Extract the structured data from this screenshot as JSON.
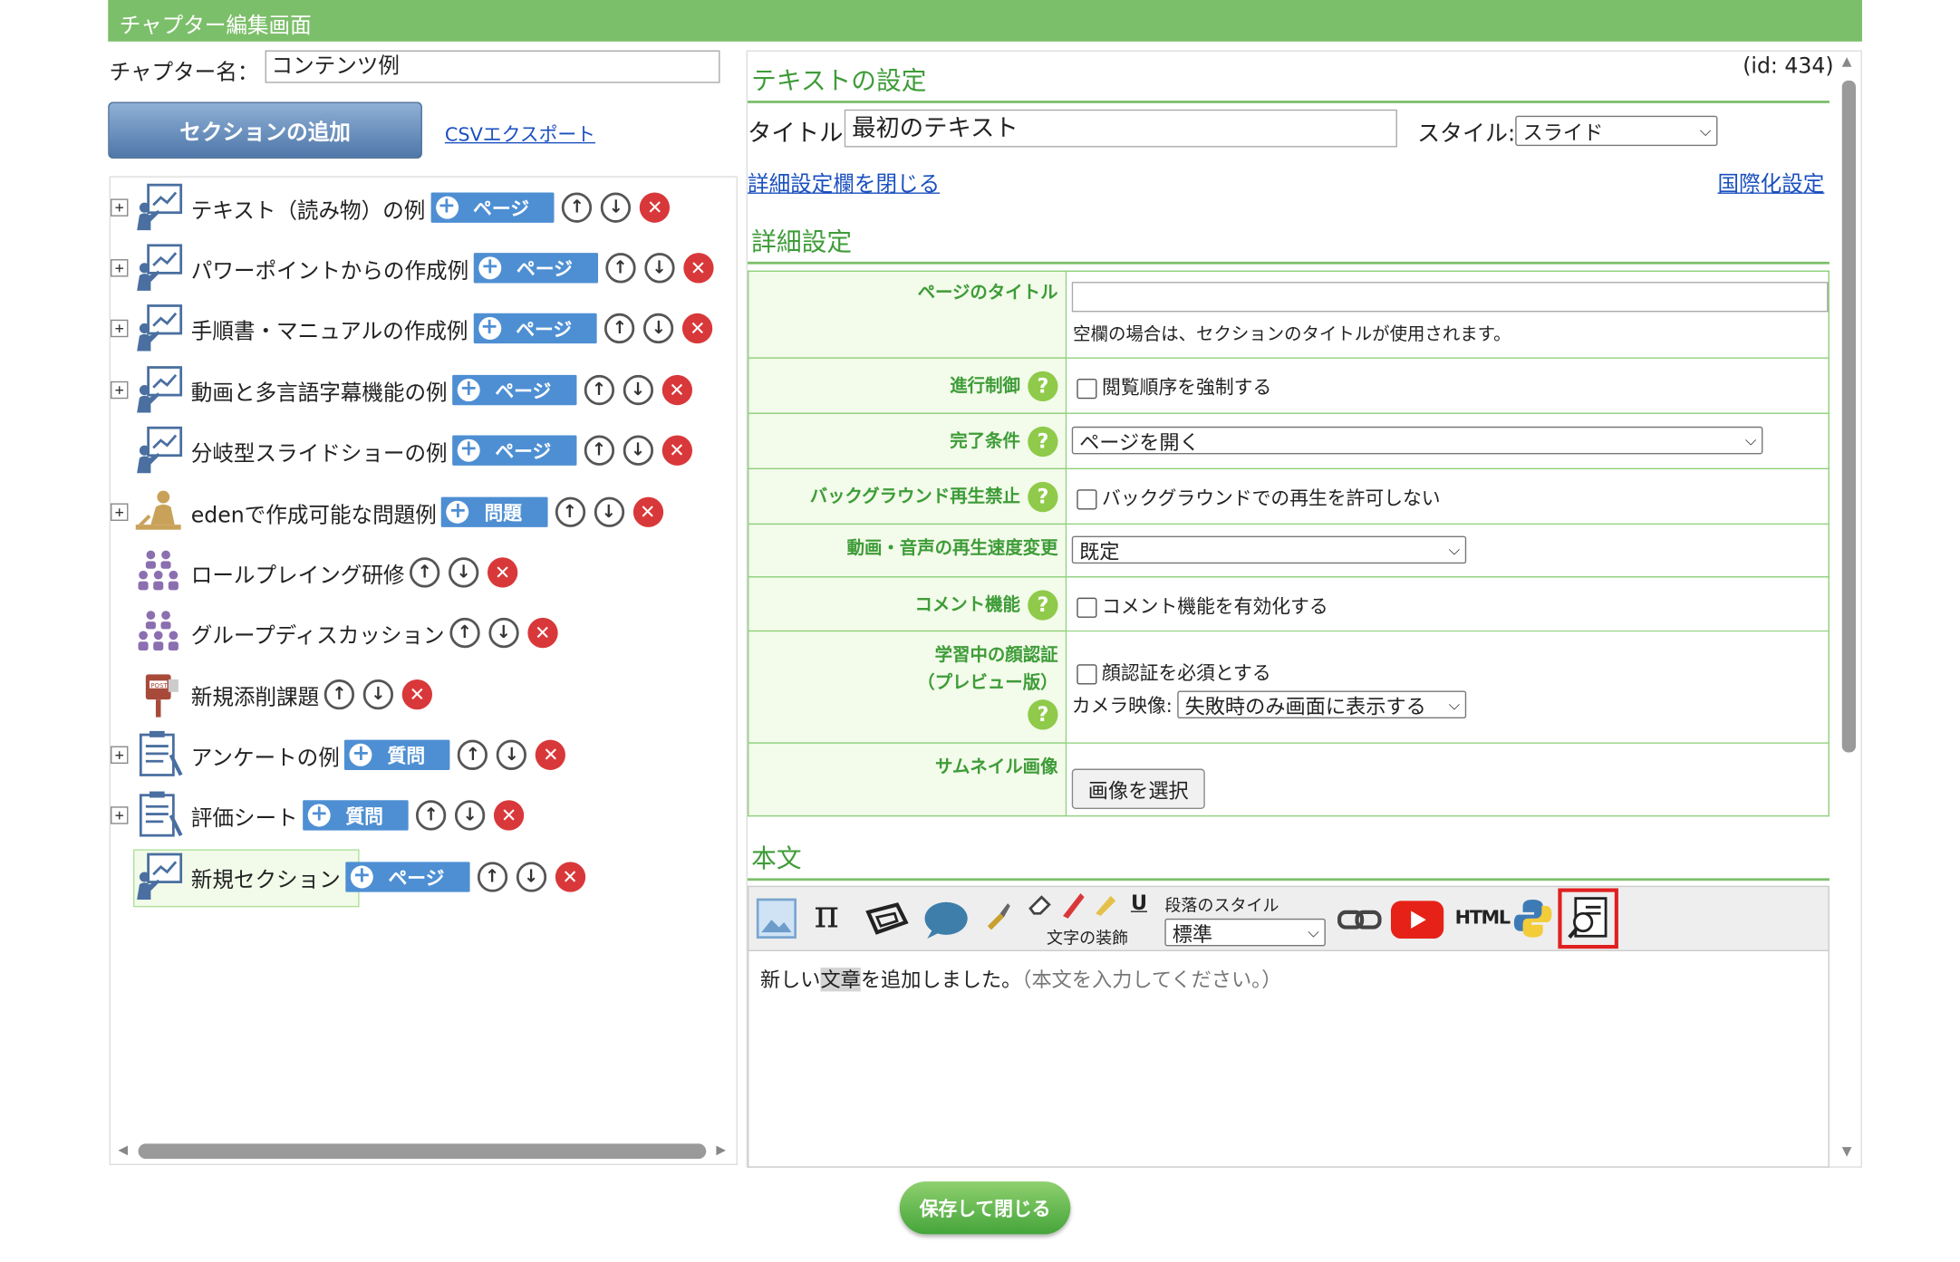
{
  "header": {
    "title": "チャプター編集画面"
  },
  "chapter": {
    "name_label": "チャプター名：",
    "name_value": "コンテンツ例"
  },
  "left": {
    "add_section_label": "セクションの追加",
    "csv_export_label": "CSVエクスポート",
    "sections": [
      {
        "label": "テキスト（読み物）の例",
        "button": "ページ"
      },
      {
        "label": "パワーポイントからの作成例",
        "button": "ページ"
      },
      {
        "label": "手順書・マニュアルの作成例",
        "button": "ページ"
      },
      {
        "label": "動画と多言語字幕機能の例",
        "button": "ページ"
      },
      {
        "label": "分岐型スライドショーの例",
        "button": "ページ"
      },
      {
        "label": "edenで作成可能な問題例",
        "button": "問題"
      },
      {
        "label": "ロールプレイング研修"
      },
      {
        "label": "グループディスカッション"
      },
      {
        "label": "新規添削課題"
      },
      {
        "label": "アンケートの例",
        "button": "質問"
      },
      {
        "label": "評価シート",
        "button": "質問"
      },
      {
        "label": "新規セクション",
        "button": "ページ"
      }
    ]
  },
  "right": {
    "id_label": "(id: 434)",
    "text_settings_heading": "テキストの設定",
    "title_label": "タイトル:",
    "title_value": "最初のテキスト",
    "style_label": "スタイル:",
    "style_value": "スライド",
    "close_detail_link": "詳細設定欄を閉じる",
    "i18n_link": "国際化設定",
    "detail_heading": "詳細設定",
    "details": {
      "page_title_label": "ページのタイトル",
      "page_title_hint": "空欄の場合は、セクションのタイトルが使用されます。",
      "progress_label": "進行制御",
      "progress_option": "閲覧順序を強制する",
      "completion_label": "完了条件",
      "completion_value": "ページを開く",
      "bg_label": "バックグラウンド再生禁止",
      "bg_option": "バックグラウンドでの再生を許可しない",
      "speed_label": "動画・音声の再生速度変更",
      "speed_value": "既定",
      "comment_label": "コメント機能",
      "comment_option": "コメント機能を有効化する",
      "face_label_1": "学習中の顔認証",
      "face_label_2": "（プレビュー版）",
      "face_option": "顔認証を必須とする",
      "camera_label": "カメラ映像:",
      "camera_value": "失敗時のみ画面に表示する",
      "thumb_label": "サムネイル画像",
      "thumb_button": "画像を選択"
    },
    "body_heading": "本文",
    "toolbar": {
      "paragraph_style_label": "段落のスタイル",
      "paragraph_style_value": "標準",
      "text_decoration_label": "文字の装飾",
      "html_label": "HTML"
    },
    "editor": {
      "text_a": "新しい",
      "text_b": "文章",
      "text_c": "を追加しました。",
      "hint": "（本文を入力してください。）"
    }
  },
  "footer": {
    "save_close_label": "保存して閉じる"
  },
  "colors": {
    "header_green": "#7cbf6a",
    "page_blue": "#4e8fd3",
    "delete_red": "#d9383a",
    "link_blue": "#1a4fbf"
  }
}
